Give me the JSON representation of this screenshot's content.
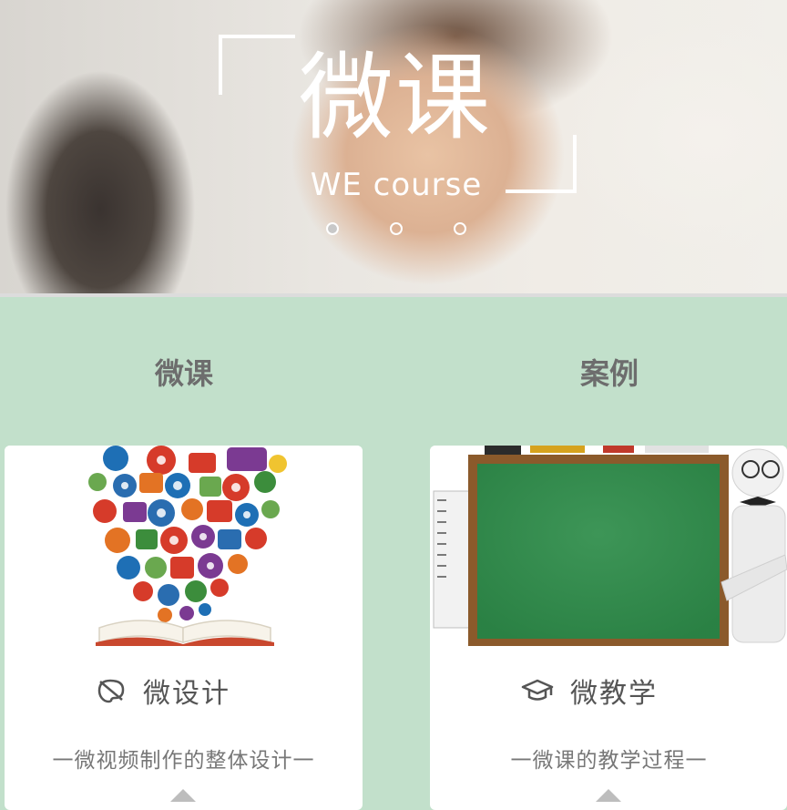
{
  "banner": {
    "title": "微课",
    "subtitle": "WE course",
    "carousel_dots": 3,
    "active_dot_index": 0
  },
  "tabs": [
    {
      "label": "微课"
    },
    {
      "label": "案例"
    }
  ],
  "cards": [
    {
      "title": "微设计",
      "icon": "design-palette-icon",
      "description": "一微视频制作的整体设计一",
      "image": "book-with-icons-illustration"
    },
    {
      "title": "微教学",
      "icon": "graduation-cap-icon",
      "description": "一微课的教学过程一",
      "image": "chalkboard-illustration"
    }
  ],
  "colors": {
    "background": "#c2e0cb",
    "card": "#ffffff",
    "tab_text": "#6d6d6d",
    "chalkboard": "#2f8a4a"
  }
}
